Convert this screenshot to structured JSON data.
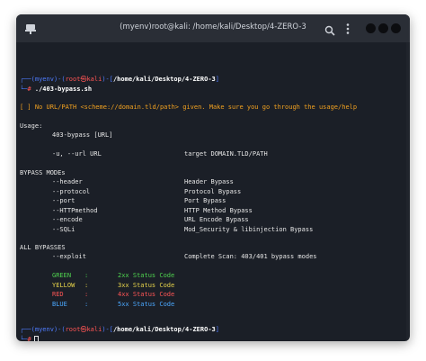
{
  "window": {
    "title": "(myenv)root@kali: /home/kali/Desktop/4-ZERO-3"
  },
  "titlebar": {
    "left_icon": "terminal-pin-icon",
    "search_icon": "search-icon",
    "menu_icon": "kebab-menu-icon",
    "window_buttons": [
      "minimize-icon",
      "maximize-icon",
      "close-icon"
    ]
  },
  "prompt1": {
    "bracket_open": "┌──(",
    "env": "myenv",
    "paren_close": ")-(",
    "user_host": "root㉿kali",
    "path_sep": ")-[",
    "path": "/home/kali/Desktop/4-ZERO-3",
    "bracket_close": "]",
    "line2_prefix": "└─",
    "hash": "#",
    "command": " ./403-bypass.sh"
  },
  "warning": {
    "mark": "[ ]",
    "text": " No URL/PATH <scheme://domain.tld/path> given. Make sure you go through the usage/help"
  },
  "usage": {
    "heading": "Usage:",
    "syntax": "403-bypass [URL]",
    "option": "-u, --url URL",
    "option_desc": "target DOMAIN.TLD/PATH"
  },
  "modes": {
    "heading": "BYPASS MODEs",
    "items": [
      {
        "flag": "--header",
        "desc": "Header Bypass"
      },
      {
        "flag": "--protocol",
        "desc": "Protocol Bypass"
      },
      {
        "flag": "--port",
        "desc": "Port Bypass"
      },
      {
        "flag": "--HTTPmethod",
        "desc": "HTTP Method Bypass"
      },
      {
        "flag": "--encode",
        "desc": "URL Encode Bypass"
      },
      {
        "flag": "--SQLi",
        "desc": "Mod_Security & libinjection Bypass"
      }
    ]
  },
  "all": {
    "heading": "ALL BYPASSES",
    "flag": "--exploit",
    "desc": "Complete Scan: 403/401 bypass modes"
  },
  "status": {
    "rows": [
      {
        "color_name": "GREEN",
        "sep": ":",
        "code": "2xx Status Code",
        "hex": "#4fd34f"
      },
      {
        "color_name": "YELLOW",
        "sep": ":",
        "code": "3xx Status Code",
        "hex": "#e6d34a"
      },
      {
        "color_name": "RED",
        "sep": ":",
        "code": "4xx Status Code",
        "hex": "#ff5555"
      },
      {
        "color_name": "BLUE",
        "sep": ":",
        "code": "5xx Status Code",
        "hex": "#4aa8ff"
      }
    ]
  },
  "prompt2": {
    "bracket_open": "┌──(",
    "env": "myenv",
    "paren_close": ")-(",
    "user_host": "root㉿kali",
    "path_sep": ")-[",
    "path": "/home/kali/Desktop/4-ZERO-3",
    "bracket_close": "]",
    "line2_prefix": "└─",
    "hash": "#"
  }
}
